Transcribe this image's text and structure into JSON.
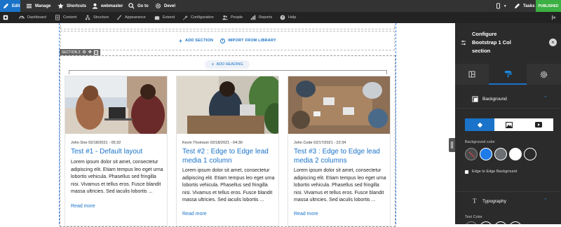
{
  "topbar": {
    "edit": "Edit",
    "manage": "Manage",
    "shortcuts": "Shortcuts",
    "user": "webmaster",
    "goto": "Go to",
    "devel": "Devel",
    "tasks": "Tasks",
    "published": "PUBLISHED"
  },
  "menu": {
    "items": [
      "Dashboard",
      "Content",
      "Structure",
      "Appearance",
      "Extend",
      "Configuration",
      "People",
      "Reports",
      "Help"
    ]
  },
  "canvas": {
    "add_section": "ADD SECTION",
    "import_library": "IMPORT FROM LIBRARY",
    "section_label": "SECTION 2",
    "add_heading": "ADD HEADING"
  },
  "cards": [
    {
      "meta": "John Doe 02/18/2021 - 05:32",
      "title": "Test #1 - Default layout",
      "body": "Lorem ipsum dolor sit amet, consectetur adipiscing elit. Etiam tempus leo eget urna lobortis vehicula. Phasellus sed fringilla nisi. Vivamus et tellus eros. Fusce blandit massa ultricies. Sed iaculis lobortis ...",
      "more": "Read more"
    },
    {
      "meta": "Kevin Thomson 02/18/2021 - 04:30",
      "title": "Test #2 : Edge to Edge lead media 1 column",
      "body": "Lorem ipsum dolor sit amet, consectetur adipiscing elit. Etiam tempus leo eget urna lobortis vehicula. Phasellus sed fringilla nisi. Vivamus et tellus eros. Fusce blandit massa ultricies. Sed iaculis lobortis ...",
      "more": "Read more"
    },
    {
      "meta": "John Code 02/17/2021 - 22:34",
      "title": "Test #3 : Edge to Edge lead media 2 columns",
      "body": "Lorem ipsum dolor sit amet, consectetur adipiscing elit. Etiam tempus leo eget urna lobortis vehicula. Phasellus sed fringilla nisi. Vivamus et tellus eros. Fusce blandit massa ultricies. Sed iaculis lobortis ...",
      "more": "Read more"
    }
  ],
  "panel": {
    "title_line1": "Configure",
    "title_line2": "Bootstrap 1 Col",
    "title_line3": "section",
    "background": "Background",
    "bg_color_label": "Background color",
    "edge_label": "Edge to Edge Background",
    "typography": "Typography",
    "text_color_label": "Text Color"
  },
  "colors": {
    "accent": "#1a73c8",
    "published": "#3cb043",
    "panel": "#2b2b2b",
    "swatches": [
      "#4a4a4a",
      "#1e7be8",
      "#6b6f73",
      "#ffffff",
      "#2b2b2b"
    ]
  }
}
